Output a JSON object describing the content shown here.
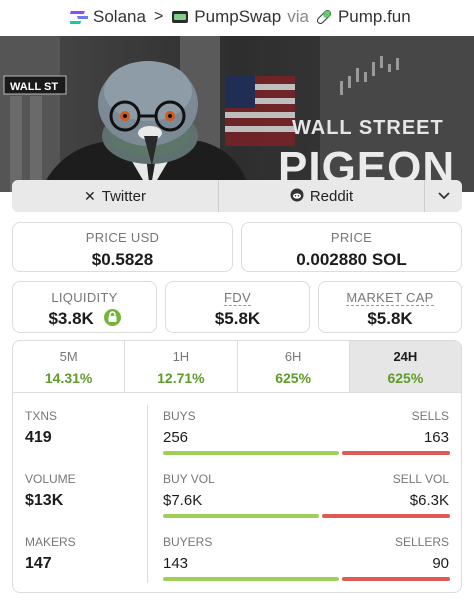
{
  "breadcrumb": {
    "chain": "Solana",
    "dex": "PumpSwap",
    "via": "via",
    "launchpad": "Pump.fun"
  },
  "banner": {
    "line1": "WALL STREET",
    "line2": "PIGEON",
    "sign": "WALL ST"
  },
  "social": {
    "twitter": "Twitter",
    "reddit": "Reddit"
  },
  "price": {
    "usd_label": "PRICE USD",
    "usd_value": "$0.5828",
    "native_label": "PRICE",
    "native_value": "0.002880 SOL"
  },
  "metrics": {
    "liquidity_label": "LIQUIDITY",
    "liquidity_value": "$3.8K",
    "fdv_label": "FDV",
    "fdv_value": "$5.8K",
    "mcap_label": "MARKET CAP",
    "mcap_value": "$5.8K"
  },
  "tabs": [
    {
      "label": "5M",
      "pct": "14.31%"
    },
    {
      "label": "1H",
      "pct": "12.71%"
    },
    {
      "label": "6H",
      "pct": "625%"
    },
    {
      "label": "24H",
      "pct": "625%"
    }
  ],
  "stats": {
    "txns_label": "TXNS",
    "txns_value": "419",
    "buys_label": "BUYS",
    "buys_value": "256",
    "sells_label": "SELLS",
    "sells_value": "163",
    "volume_label": "VOLUME",
    "volume_value": "$13K",
    "buyvol_label": "BUY VOL",
    "buyvol_value": "$7.6K",
    "sellvol_label": "SELL VOL",
    "sellvol_value": "$6.3K",
    "makers_label": "MAKERS",
    "makers_value": "147",
    "buyers_label": "BUYERS",
    "buyers_value": "143",
    "sellers_label": "SELLERS",
    "sellers_value": "90"
  },
  "colors": {
    "positive": "#5e9b2a",
    "buy_bar": "#9fcf5a",
    "sell_bar": "#e05a55"
  }
}
